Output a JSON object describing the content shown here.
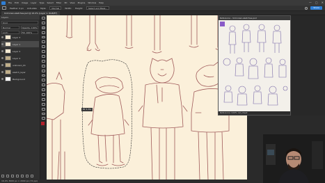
{
  "menubar": {
    "items": [
      "File",
      "Edit",
      "Image",
      "Layer",
      "Type",
      "Select",
      "Filter",
      "3D",
      "View",
      "Plugins",
      "Window",
      "Help"
    ],
    "window_controls": [
      "—",
      "▢",
      "✕"
    ]
  },
  "options": {
    "items": [
      "Feather: 0 px",
      "Anti-alias",
      "Style:",
      "Normal",
      "Width:",
      "Height:",
      "Select and Mask..."
    ],
    "share_label": "Share"
  },
  "document": {
    "tab_label": "Unknown-sketches.psd @ 16.4% (Layer 1, RGB/8*)"
  },
  "layers_panel": {
    "title": "Layers",
    "kind_label": "Kind",
    "blend_mode": "Normal",
    "opacity_label": "Opacity: 100%",
    "lock_label": "Lock:",
    "fill_label": "Fill: 100%",
    "layers": [
      {
        "name": "Layer 3",
        "selected": false
      },
      {
        "name": "Layer 1",
        "selected": true
      },
      {
        "name": "Layer 2",
        "selected": false
      },
      {
        "name": "Layer 4",
        "selected": false
      },
      {
        "name": "unknown_01",
        "selected": false
      },
      {
        "name": "sketch_layer",
        "selected": false
      },
      {
        "name": "Background",
        "selected": false
      }
    ]
  },
  "reference_panel": {
    "title": "Reference - Unknown-sketches.psd",
    "footer": "Reference 100% ref_sheet"
  },
  "canvas": {
    "selection_tooltip": "W: 1.7in"
  },
  "status": {
    "text": "16.4%   3000 px × 2000 px (72 ppi)"
  },
  "colors": {
    "accent": "#2f7fd6",
    "canvas_bg": "#fbf0da",
    "sketch_line": "#a05a5a",
    "ref_line": "#7a6aa8",
    "foreground_swatch": "#b2202a",
    "background_swatch": "#ffffff"
  }
}
